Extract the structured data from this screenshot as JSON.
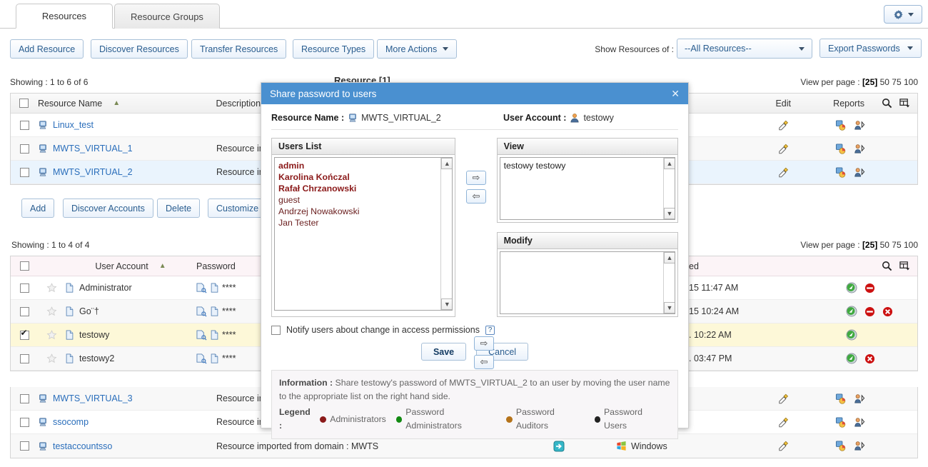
{
  "tabs": [
    {
      "label": "Resources",
      "active": true
    },
    {
      "label": "Resource Groups",
      "active": false
    }
  ],
  "toolbar": {
    "add_resource": "Add Resource",
    "discover_resources": "Discover Resources",
    "transfer_resources": "Transfer Resources",
    "resource_types": "Resource Types",
    "more_actions": "More Actions",
    "show_resources_of_label": "Show Resources of :",
    "resources_filter_value": "--All Resources--",
    "export_passwords": "Export Passwords"
  },
  "resources_section": {
    "showing": "Showing : 1 to 6 of 6",
    "view_per_page_label": "View per page : ",
    "view_per_page_selected": "[25]",
    "view_per_page_options": " 50 75 100",
    "ghost_title": "Resource [1]",
    "columns": {
      "resource_name": "Resource Name",
      "description": "Description",
      "edit": "Edit",
      "reports": "Reports"
    },
    "rows": [
      {
        "name": "Linux_test",
        "description": "",
        "type": "",
        "row_style": "plain"
      },
      {
        "name": "MWTS_VIRTUAL_1",
        "description": "Resource imp",
        "type": "",
        "row_style": "alt"
      },
      {
        "name": "MWTS_VIRTUAL_2",
        "description": "Resource imp",
        "type": "",
        "row_style": "sel"
      }
    ],
    "bottom_rows": [
      {
        "name": "MWTS_VIRTUAL_3",
        "description": "Resource imp",
        "type": "",
        "row_style": "alt"
      },
      {
        "name": "ssocomp",
        "description": "Resource imp",
        "type": "",
        "row_style": "plain"
      },
      {
        "name": "testaccountsso",
        "description": "Resource imported from domain : MWTS",
        "type": "Windows",
        "row_style": "alt"
      }
    ]
  },
  "accounts_section": {
    "buttons": {
      "add": "Add",
      "discover_accounts": "Discover Accounts",
      "delete": "Delete",
      "customize": "Customize F"
    },
    "showing": "Showing : 1 to 4 of 4",
    "view_per_page_label": "View per page : ",
    "view_per_page_selected": "[25]",
    "view_per_page_options": " 50 75 100",
    "columns": {
      "user_account": "User Account",
      "password": "Password",
      "accessed": "ed"
    },
    "rows": [
      {
        "user": "Administrator",
        "password": "****",
        "accessed": "15 11:47 AM",
        "row_style": "plain",
        "checked": false,
        "actions": [
          "access",
          "deny"
        ]
      },
      {
        "user": "Go¨†",
        "password": "****",
        "accessed": "15 10:24 AM",
        "row_style": "alt",
        "checked": false,
        "actions": [
          "access",
          "deny",
          "revoke"
        ]
      },
      {
        "user": "testowy",
        "password": "****",
        "accessed": ". 10:22 AM",
        "row_style": "hl",
        "checked": true,
        "actions": [
          "access"
        ]
      },
      {
        "user": "testowy2",
        "password": "****",
        "accessed": ". 03:47 PM",
        "row_style": "alt",
        "checked": false,
        "actions": [
          "access",
          "revoke"
        ]
      }
    ]
  },
  "modal": {
    "title": "Share password to users",
    "close_label": "✕",
    "resource_name_label": "Resource Name :",
    "resource_name_value": "MWTS_VIRTUAL_2",
    "user_account_label": "User Account :",
    "user_account_value": "testowy",
    "users_list_header": "Users List",
    "users_list": [
      {
        "name": "admin",
        "role": "administrator"
      },
      {
        "name": "Karolina Kończal",
        "role": "administrator"
      },
      {
        "name": "Rafał Chrzanowski",
        "role": "administrator"
      },
      {
        "name": "guest",
        "role": "user"
      },
      {
        "name": "Andrzej Nowakowski",
        "role": "user"
      },
      {
        "name": "Jan Tester",
        "role": "user"
      }
    ],
    "view_header": "View",
    "view_list": [
      "testowy testowy"
    ],
    "modify_header": "Modify",
    "modify_list": [],
    "move_right_label": "⇨",
    "move_left_label": "⇦",
    "notify_label": "Notify users about change in access permissions",
    "notify_checked": false,
    "help_label": "?",
    "save_label": "Save",
    "cancel_label": "Cancel",
    "information_label": "Information :",
    "information_text": " Share testowy's password of MWTS_VIRTUAL_2 to an user by moving the user name to the appropriate list on the right hand side.",
    "legend_label": "Legend :",
    "legend": [
      {
        "label": "Administrators",
        "color": "#8b1a1a"
      },
      {
        "label": "Password Administrators",
        "color": "#128a12"
      },
      {
        "label": "Password Auditors",
        "color": "#b5731a"
      },
      {
        "label": "Password Users",
        "color": "#222222"
      }
    ]
  },
  "colors": {
    "title_bar": "#4a90d0",
    "link": "#2a6ebb",
    "highlight_row": "#fdf8d8",
    "selected_row": "#eaf4fd"
  }
}
